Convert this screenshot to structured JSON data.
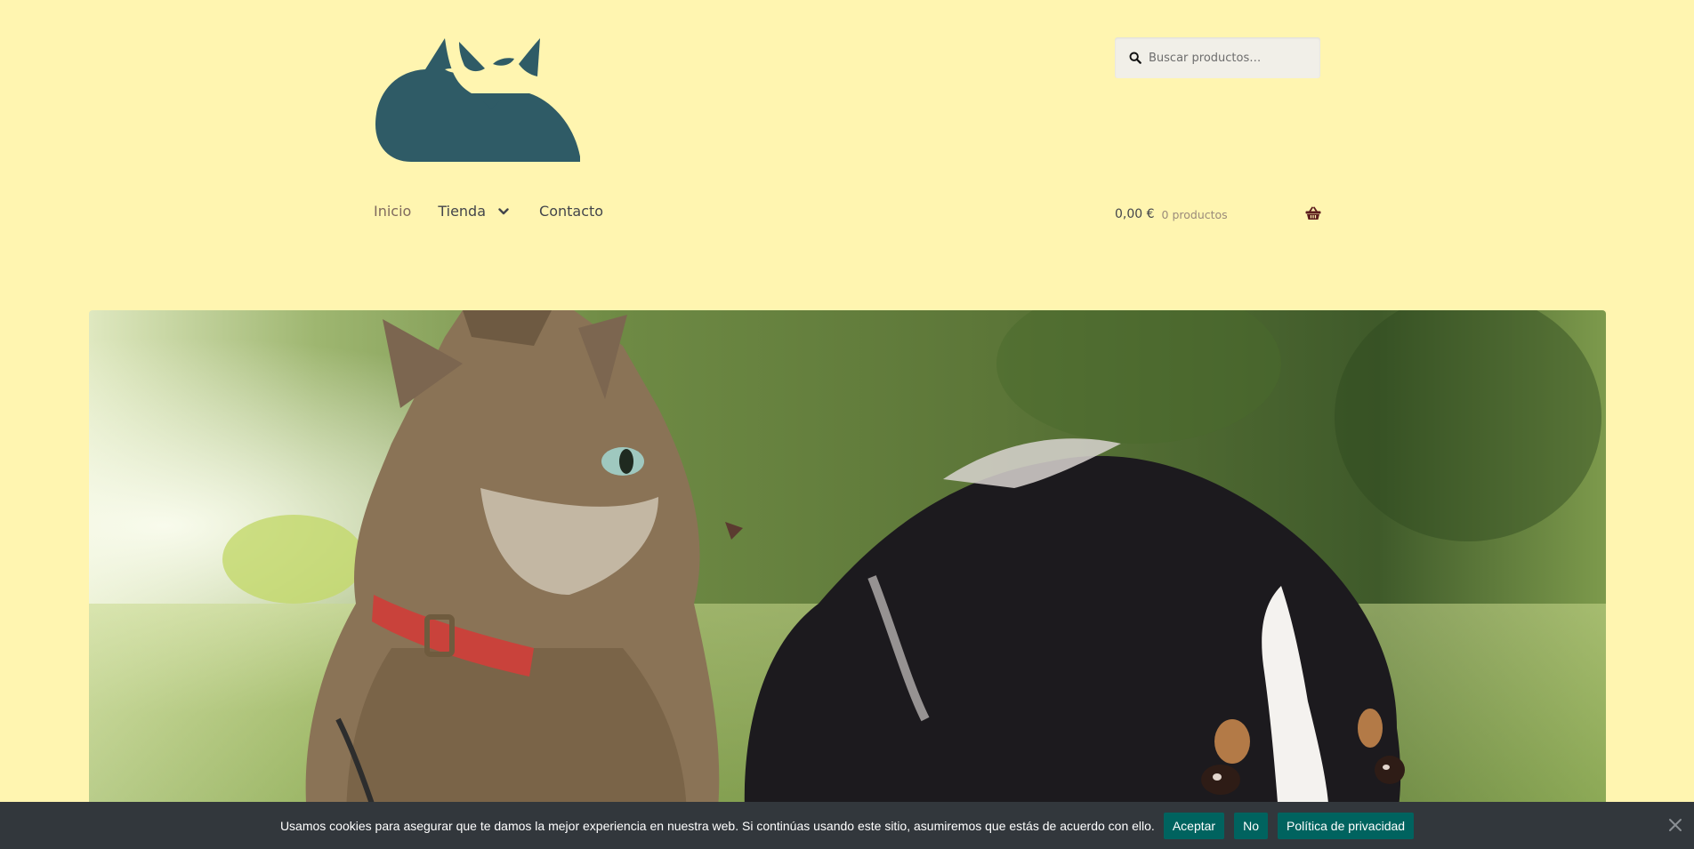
{
  "search": {
    "placeholder": "Buscar productos…"
  },
  "nav": {
    "items": [
      {
        "label": "Inicio"
      },
      {
        "label": "Tienda"
      },
      {
        "label": "Contacto"
      }
    ]
  },
  "cart": {
    "amount": "0,00 €",
    "count": "0 productos"
  },
  "cookie": {
    "message": "Usamos cookies para asegurar que te damos la mejor experiencia en nuestra web. Si continúas usando este sitio, asumiremos que estás de acuerdo con ello.",
    "accept": "Aceptar",
    "decline": "No",
    "policy": "Política de privacidad"
  },
  "colors": {
    "background": "#fff5b0",
    "brand": "#2f5b66",
    "cookie_bar": "#32373c",
    "cookie_button": "#00635f"
  },
  "icons": [
    "cat-logo",
    "search-icon",
    "chevron-down-icon",
    "basket-icon",
    "close-icon"
  ]
}
